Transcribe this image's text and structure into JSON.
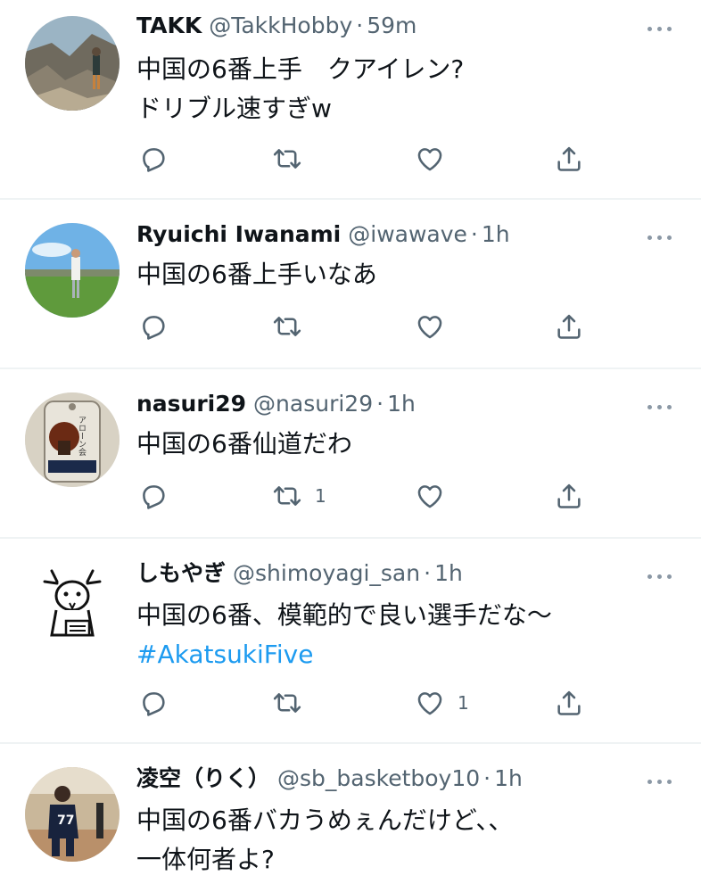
{
  "tweets": [
    {
      "name": "TAKK",
      "handle": "@TakkHobby",
      "time": "59m",
      "lines": [
        "中国の6番上手　クアイレン?",
        "ドリブル速すぎw"
      ],
      "retweets": "",
      "likes": ""
    },
    {
      "name": "Ryuichi Iwanami",
      "handle": "@iwawave",
      "time": "1h",
      "lines": [
        "中国の6番上手いなあ"
      ],
      "retweets": "",
      "likes": ""
    },
    {
      "name": "nasuri29",
      "handle": "@nasuri29",
      "time": "1h",
      "lines": [
        "中国の6番仙道だわ"
      ],
      "retweets": "1",
      "likes": ""
    },
    {
      "name": "しもやぎ",
      "handle": "@shimoyagi_san",
      "time": "1h",
      "lines": [
        "中国の6番、模範的で良い選手だな～"
      ],
      "hashtag": "#AkatsukiFive",
      "retweets": "",
      "likes": "1"
    },
    {
      "name": "凌空（りく）",
      "handle": "@sb_basketboy10",
      "time": "1h",
      "lines": [
        "中国の6番バカうめぇんだけど、、",
        "一体何者よ?"
      ],
      "retweets": "",
      "likes": ""
    }
  ],
  "avatar_badges": {
    "nasuri29_tag": "アローン会",
    "player_number": "77"
  },
  "colors": {
    "text": "#0f1419",
    "secondary": "#536471",
    "link": "#1d9bf0",
    "icon": "#536471",
    "divider": "#eff3f4"
  },
  "icons": [
    "reply-icon",
    "retweet-icon",
    "like-icon",
    "share-icon",
    "more-icon"
  ]
}
